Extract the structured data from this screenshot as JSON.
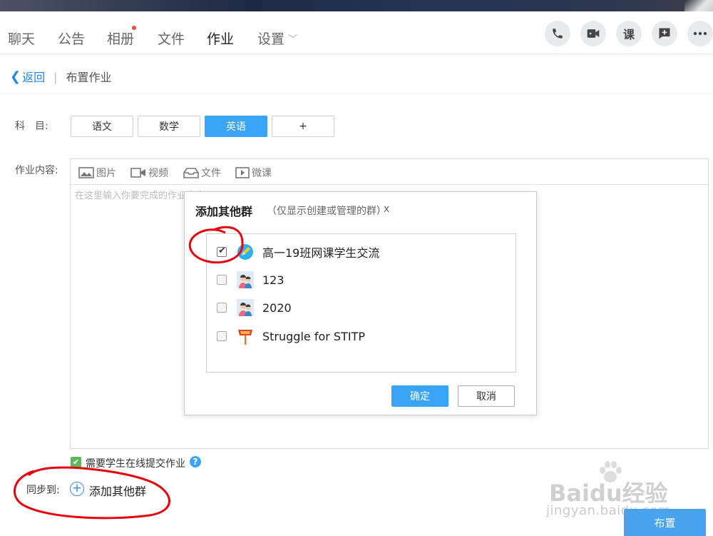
{
  "nav": {
    "tabs": [
      "聊天",
      "公告",
      "相册",
      "文件",
      "作业",
      "设置"
    ],
    "active_index": 4,
    "course_icon_label": "课"
  },
  "breadcrumb": {
    "back": "返回",
    "separator": "|",
    "current": "布置作业"
  },
  "subject": {
    "label": "科　目:",
    "options": [
      "语文",
      "数学",
      "英语",
      "+"
    ],
    "selected": "英语"
  },
  "content": {
    "label": "作业内容:",
    "tools": [
      {
        "icon": "image-icon",
        "label": "图片"
      },
      {
        "icon": "video-icon",
        "label": "视频"
      },
      {
        "icon": "file-tray-icon",
        "label": "文件"
      },
      {
        "icon": "play-icon",
        "label": "微课"
      }
    ],
    "placeholder": "在这里输入你要完成的作业内容"
  },
  "dialog": {
    "title": "添加其他群",
    "subtitle": "（仅显示创建或管理的群）",
    "close": "x",
    "groups": [
      {
        "name": "高一19班网课学生交流",
        "checked": true,
        "avatar": "pencil-avatar-icon"
      },
      {
        "name": "123",
        "checked": false,
        "avatar": "couple-avatar-icon"
      },
      {
        "name": "2020",
        "checked": false,
        "avatar": "couple-avatar-icon"
      },
      {
        "name": "Struggle for STITP",
        "checked": false,
        "avatar": "sign-avatar-icon"
      }
    ],
    "ok": "确定",
    "cancel": "取消"
  },
  "submit_online": {
    "label": "需要学生在线提交作业",
    "checked": true,
    "help": "?"
  },
  "sync": {
    "label": "同步到:",
    "add_group": "添加其他群"
  },
  "publish": "布置",
  "watermark": {
    "logo": "Baidu经验",
    "url": "jingyan.baidu.com"
  },
  "colors": {
    "accent": "#3aa4f5",
    "annotation": "#e8000b",
    "check_green": "#5cb85c",
    "notify_dot": "#e74c3c"
  }
}
